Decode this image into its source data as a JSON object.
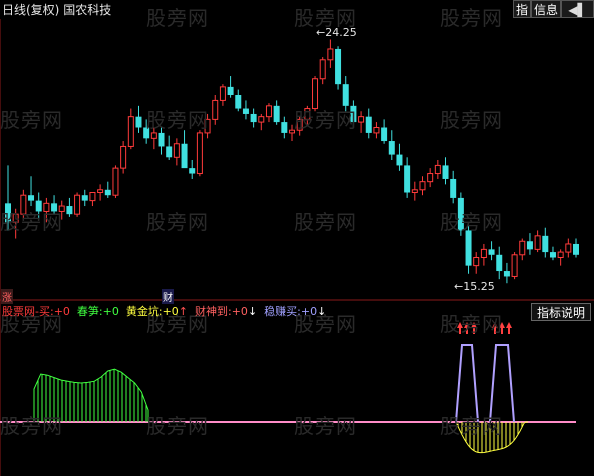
{
  "header": {
    "period": "日线(复权)",
    "stock_name": "国农科技",
    "buttons": {
      "indicator": "指",
      "info": "信息",
      "arrow": "◀▌"
    }
  },
  "watermark": "股旁网",
  "price_labels": {
    "high": "24.25",
    "low": "15.25"
  },
  "badges": {
    "zhang": "涨",
    "cai": "财"
  },
  "indicator_line": {
    "items": [
      {
        "label": "股票网-买:",
        "value": "+0",
        "color": "#ff3b3b",
        "arrow": ""
      },
      {
        "label": "春笋:",
        "value": "+0",
        "color": "#40ff40",
        "arrow": ""
      },
      {
        "label": "黄金坑:",
        "value": "+0",
        "color": "#ffff40",
        "arrow": "↑"
      },
      {
        "label": "财神到:",
        "value": "+0",
        "color": "#ff6060",
        "arrow": "↓"
      },
      {
        "label": "稳赚买:",
        "value": "+0",
        "color": "#a0a0ff",
        "arrow": "↓"
      }
    ],
    "help_button": "指标说明"
  },
  "chart_data": {
    "type": "candlestick",
    "price_high": 24.25,
    "price_low": 15.25,
    "candles": [
      [
        18.2,
        19.6,
        17.2,
        17.5
      ],
      [
        17.5,
        18.0,
        16.9,
        17.8
      ],
      [
        17.8,
        18.7,
        17.6,
        18.5
      ],
      [
        18.5,
        19.2,
        18.1,
        18.3
      ],
      [
        18.3,
        18.6,
        17.6,
        17.9
      ],
      [
        17.9,
        18.4,
        17.5,
        18.2
      ],
      [
        18.2,
        18.5,
        17.8,
        17.9
      ],
      [
        17.9,
        18.3,
        17.6,
        18.1
      ],
      [
        18.1,
        18.4,
        17.7,
        17.8
      ],
      [
        17.8,
        18.6,
        17.7,
        18.5
      ],
      [
        18.5,
        18.7,
        18.1,
        18.3
      ],
      [
        18.3,
        18.6,
        18.1,
        18.6
      ],
      [
        18.6,
        18.9,
        18.3,
        18.7
      ],
      [
        18.7,
        19.0,
        18.4,
        18.5
      ],
      [
        18.5,
        19.6,
        18.4,
        19.5
      ],
      [
        19.5,
        20.5,
        19.3,
        20.3
      ],
      [
        20.3,
        21.7,
        20.2,
        21.4
      ],
      [
        21.4,
        21.8,
        20.8,
        21.0
      ],
      [
        21.0,
        21.3,
        20.4,
        20.6
      ],
      [
        20.6,
        21.0,
        20.2,
        20.8
      ],
      [
        20.8,
        21.0,
        20.0,
        20.3
      ],
      [
        20.3,
        20.7,
        19.8,
        19.9
      ],
      [
        19.9,
        20.6,
        19.6,
        20.4
      ],
      [
        20.4,
        20.9,
        19.8,
        19.5
      ],
      [
        19.5,
        19.8,
        19.1,
        19.3
      ],
      [
        19.3,
        20.9,
        19.2,
        20.8
      ],
      [
        20.8,
        21.5,
        20.6,
        21.3
      ],
      [
        21.3,
        22.2,
        21.1,
        22.0
      ],
      [
        22.0,
        22.6,
        21.8,
        22.5
      ],
      [
        22.5,
        22.9,
        22.1,
        22.2
      ],
      [
        22.2,
        22.4,
        21.6,
        21.7
      ],
      [
        21.7,
        22.0,
        21.3,
        21.5
      ],
      [
        21.5,
        21.7,
        21.0,
        21.2
      ],
      [
        21.2,
        21.5,
        20.9,
        21.4
      ],
      [
        21.4,
        21.9,
        21.2,
        21.8
      ],
      [
        21.8,
        22.0,
        21.1,
        21.2
      ],
      [
        21.2,
        21.4,
        20.6,
        20.8
      ],
      [
        20.8,
        21.1,
        20.5,
        20.9
      ],
      [
        20.9,
        21.4,
        20.7,
        21.3
      ],
      [
        21.3,
        21.8,
        21.1,
        21.7
      ],
      [
        21.7,
        22.9,
        21.6,
        22.8
      ],
      [
        22.8,
        23.6,
        22.6,
        23.5
      ],
      [
        23.5,
        24.25,
        23.2,
        23.9
      ],
      [
        23.9,
        24.0,
        22.4,
        22.6
      ],
      [
        22.6,
        22.9,
        21.6,
        21.8
      ],
      [
        21.8,
        22.0,
        21.0,
        21.2
      ],
      [
        21.2,
        21.6,
        20.8,
        21.4
      ],
      [
        21.4,
        21.7,
        20.6,
        20.8
      ],
      [
        20.8,
        21.2,
        20.6,
        21.0
      ],
      [
        21.0,
        21.3,
        20.4,
        20.5
      ],
      [
        20.5,
        20.9,
        19.8,
        20.0
      ],
      [
        20.0,
        20.4,
        19.4,
        19.6
      ],
      [
        19.6,
        19.9,
        18.4,
        18.6
      ],
      [
        18.6,
        19.0,
        18.3,
        18.7
      ],
      [
        18.7,
        19.2,
        18.5,
        19.0
      ],
      [
        19.0,
        19.5,
        18.8,
        19.3
      ],
      [
        19.3,
        19.8,
        19.1,
        19.6
      ],
      [
        19.6,
        19.9,
        18.9,
        19.1
      ],
      [
        19.1,
        19.4,
        18.2,
        18.4
      ],
      [
        18.4,
        18.6,
        17.0,
        17.2
      ],
      [
        17.2,
        17.4,
        15.6,
        15.9
      ],
      [
        15.9,
        16.4,
        15.6,
        16.2
      ],
      [
        16.2,
        16.7,
        15.9,
        16.5
      ],
      [
        16.5,
        16.8,
        16.1,
        16.3
      ],
      [
        16.3,
        16.6,
        15.4,
        15.7
      ],
      [
        15.7,
        16.0,
        15.25,
        15.5
      ],
      [
        15.5,
        16.4,
        15.4,
        16.3
      ],
      [
        16.3,
        16.9,
        16.1,
        16.8
      ],
      [
        16.8,
        17.1,
        16.3,
        16.5
      ],
      [
        16.5,
        17.2,
        16.4,
        17.0
      ],
      [
        17.0,
        17.3,
        16.2,
        16.4
      ],
      [
        16.4,
        16.6,
        16.1,
        16.2
      ],
      [
        16.2,
        16.5,
        15.9,
        16.4
      ],
      [
        16.4,
        16.9,
        16.2,
        16.7
      ],
      [
        16.7,
        16.9,
        16.2,
        16.3
      ]
    ],
    "hatch_green": {
      "x_range": [
        34,
        148
      ],
      "levels": [
        0.55,
        0.8,
        0.78,
        0.74,
        0.7,
        0.68,
        0.66,
        0.65,
        0.66,
        0.68,
        0.75,
        0.85,
        0.88,
        0.83,
        0.74,
        0.65,
        0.5,
        0.2
      ]
    },
    "tower_purple": [
      [
        456,
        478
      ],
      [
        490,
        514
      ]
    ],
    "hatch_yellow": {
      "x_range": [
        456,
        528
      ]
    },
    "baseline_color": "#ff8cc8"
  }
}
